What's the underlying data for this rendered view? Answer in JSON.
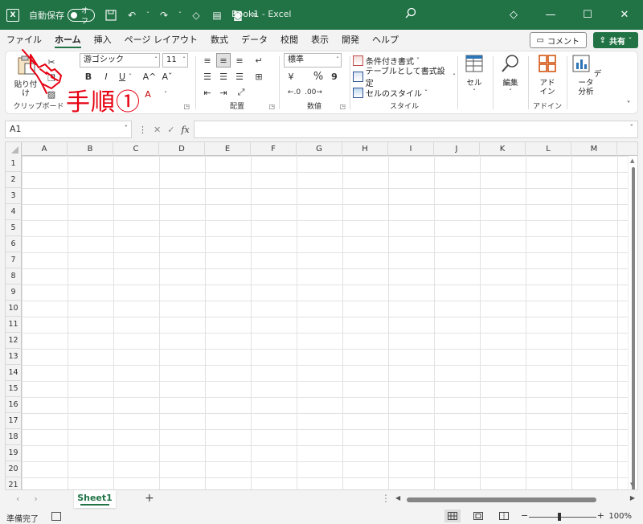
{
  "titlebar": {
    "autosave_label": "自動保存",
    "autosave_state": "オフ",
    "doc_title": "Book1  -  Excel"
  },
  "menu": {
    "tabs": [
      "ファイル",
      "ホーム",
      "挿入",
      "ページ レイアウト",
      "数式",
      "データ",
      "校閲",
      "表示",
      "開発",
      "ヘルプ"
    ],
    "active_tab": "ホーム",
    "comment_label": "コメント",
    "share_label": "共有"
  },
  "ribbon": {
    "clipboard": {
      "paste_label": "貼り付け",
      "group_label": "クリップボード"
    },
    "font": {
      "name": "游ゴシック",
      "size": "11",
      "bold": "B",
      "italic": "I",
      "underline": "U",
      "grow": "A^",
      "shrink": "Aˇ"
    },
    "alignment": {
      "group_label": "配置"
    },
    "number": {
      "format": "標準",
      "percent": "%",
      "comma": "9",
      "group_label": "数値"
    },
    "styles": {
      "conditional": "条件付き書式",
      "as_table": "テーブルとして書式設定",
      "cell_styles": "セルのスタイル",
      "group_label": "スタイル"
    },
    "cells": {
      "label": "セル"
    },
    "editing": {
      "label": "編集"
    },
    "addins": {
      "label_line1": "アド",
      "label_line2": "イン",
      "group_label": "アドイン"
    },
    "analysis": {
      "label_line1": "データ",
      "label_line2": "分析"
    }
  },
  "annotation": {
    "text": "手順①"
  },
  "formula_bar": {
    "name_box": "A1",
    "fx": "fx",
    "value": ""
  },
  "grid": {
    "columns": [
      "A",
      "B",
      "C",
      "D",
      "E",
      "F",
      "G",
      "H",
      "I",
      "J",
      "K",
      "L",
      "M"
    ],
    "rows": [
      "1",
      "2",
      "3",
      "4",
      "5",
      "6",
      "7",
      "8",
      "9",
      "10",
      "11",
      "12",
      "13",
      "14",
      "15",
      "16",
      "17",
      "18",
      "19",
      "20",
      "21"
    ]
  },
  "sheets": {
    "tabs": [
      "Sheet1"
    ],
    "active": "Sheet1",
    "add_label": "+"
  },
  "status": {
    "ready": "準備完了",
    "zoom": "100%"
  },
  "colors": {
    "accent": "#217346",
    "annotation": "#e60012"
  }
}
